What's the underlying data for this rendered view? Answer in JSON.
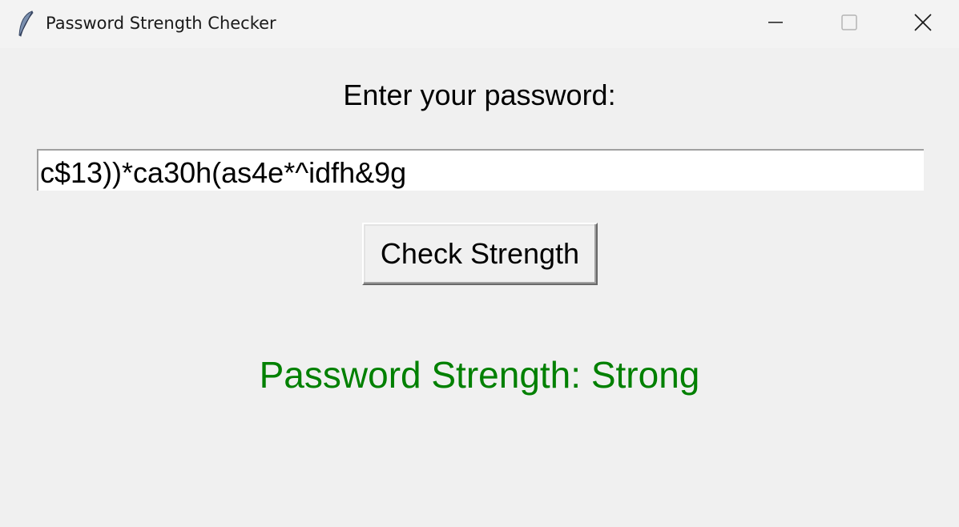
{
  "window": {
    "title": "Password Strength Checker",
    "app_icon": "feather-icon"
  },
  "title_controls": {
    "minimize_icon": "minimize-icon",
    "maximize_icon": "maximize-icon",
    "close_icon": "close-icon"
  },
  "form": {
    "prompt": "Enter your password:",
    "password_value": "c$13))*ca30h(as4e*^idfh&9g",
    "check_button_label": "Check Strength"
  },
  "result": {
    "text": "Password Strength: Strong",
    "color": "#008000"
  },
  "colors": {
    "background": "#f0f0f0",
    "titlebar": "#f3f3f3",
    "input_background": "#ffffff"
  }
}
